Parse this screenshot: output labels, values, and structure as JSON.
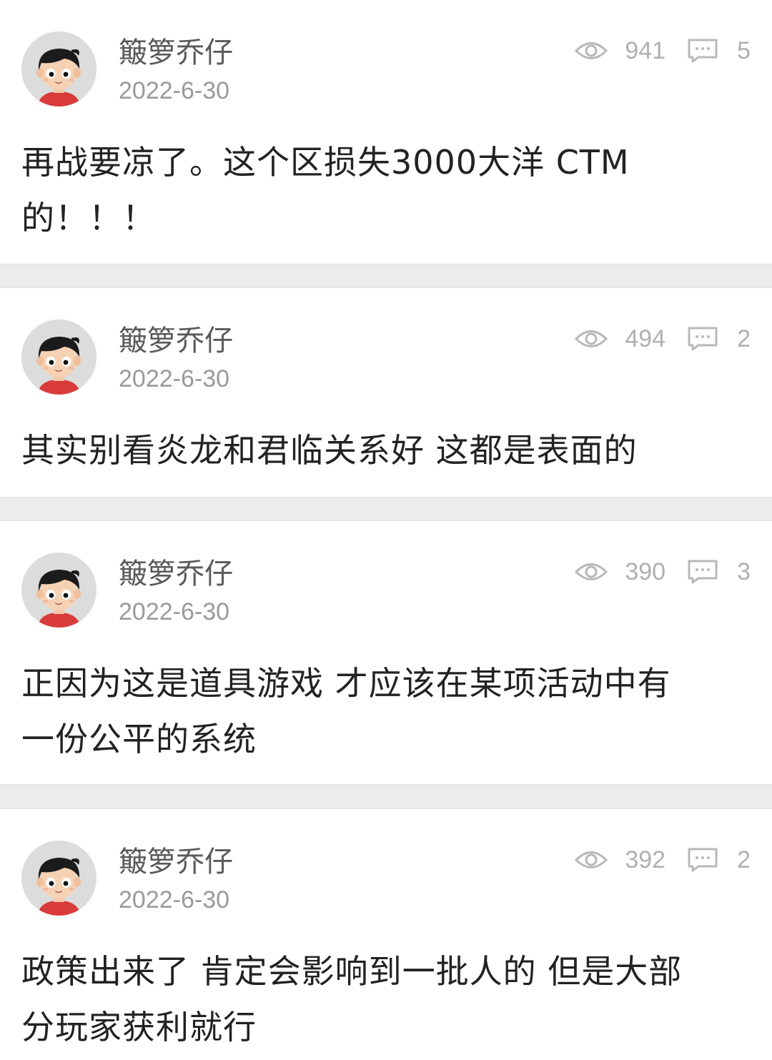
{
  "posts": [
    {
      "username": "簸箩乔仔",
      "date": "2022-6-30",
      "views": "941",
      "comments": "5",
      "lines": [
        "再战要凉了。这个区损失3000大洋 CTM",
        "的！！！"
      ]
    },
    {
      "username": "簸箩乔仔",
      "date": "2022-6-30",
      "views": "494",
      "comments": "2",
      "lines": [
        "其实别看炎龙和君临关系好 这都是表面的"
      ]
    },
    {
      "username": "簸箩乔仔",
      "date": "2022-6-30",
      "views": "390",
      "comments": "3",
      "lines": [
        "正因为这是道具游戏 才应该在某项活动中有",
        "一份公平的系统"
      ]
    },
    {
      "username": "簸箩乔仔",
      "date": "2022-6-30",
      "views": "392",
      "comments": "2",
      "lines": [
        "政策出来了 肯定会影响到一批人的 但是大部",
        "分玩家获利就行"
      ]
    }
  ],
  "icons": {
    "views": "eye-icon",
    "comments": "comment-icon",
    "avatar": "cartoon-boy-avatar"
  },
  "colors": {
    "background": "#ececec",
    "card": "#ffffff",
    "text": "#222222",
    "meta": "#9a9a9a",
    "stats": "#b0b0b0"
  }
}
